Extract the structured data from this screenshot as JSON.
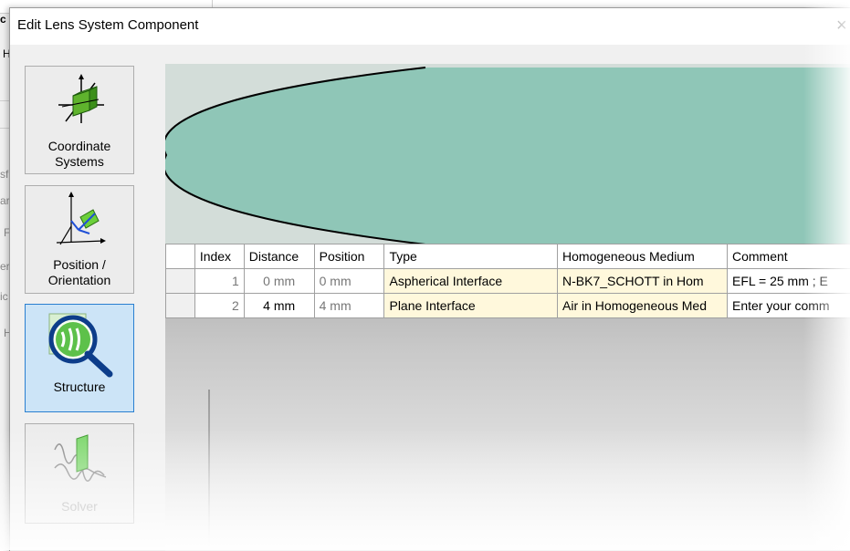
{
  "dialog": {
    "title": "Edit Lens System Component",
    "close_glyph": "×"
  },
  "background_window": {
    "fragments": [
      "c",
      "H",
      "sf",
      "ar",
      "F",
      "er",
      "ic",
      "H"
    ]
  },
  "nav": [
    {
      "label": "Coordinate Systems",
      "icon": "coordinate-systems-icon",
      "selected": false,
      "enabled": true
    },
    {
      "label": "Position / Orientation",
      "icon": "position-orientation-icon",
      "selected": false,
      "enabled": true
    },
    {
      "label": "Structure",
      "icon": "structure-icon",
      "selected": true,
      "enabled": true
    },
    {
      "label": "Solver",
      "icon": "solver-icon",
      "selected": false,
      "enabled": false
    }
  ],
  "nav_labels": {
    "coord_line1": "Coordinate",
    "coord_line2": "Systems",
    "pos_line1": "Position /",
    "pos_line2": "Orientation",
    "structure": "Structure",
    "solver": "Solver"
  },
  "preview": {
    "lens_fill": "#8fc6b7",
    "background": "#d3ddd9",
    "outline": "#000000"
  },
  "table": {
    "columns": [
      "Index",
      "Distance",
      "Position",
      "Type",
      "Homogeneous Medium",
      "Comment"
    ],
    "rows": [
      {
        "index": "1",
        "distance": "0 mm",
        "position": "0 mm",
        "type": "Aspherical Interface",
        "medium": "N-BK7_SCHOTT in Hom",
        "comment": "EFL = 25 mm ; E"
      },
      {
        "index": "2",
        "distance": "4 mm",
        "position": "4 mm",
        "type": "Plane Interface",
        "medium": "Air in Homogeneous Med",
        "comment": "Enter your comm"
      }
    ]
  },
  "colors": {
    "selected_nav": "#cce4f7",
    "selected_nav_border": "#2a7fd0",
    "editable_cell": "#fff8dc"
  }
}
